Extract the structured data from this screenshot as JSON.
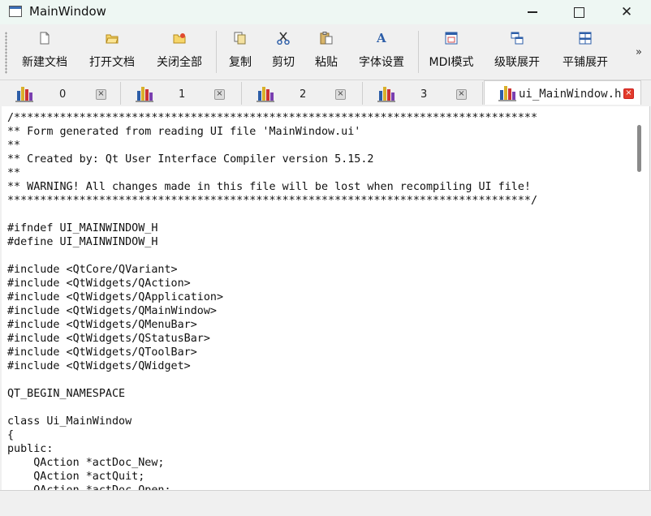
{
  "window": {
    "title": "MainWindow",
    "minimize_label": "–",
    "close_label": "✕"
  },
  "toolbar": {
    "buttons": [
      {
        "label": "新建文档",
        "icon": "new-document-icon"
      },
      {
        "label": "打开文档",
        "icon": "open-folder-icon"
      },
      {
        "label": "关闭全部",
        "icon": "close-all-icon"
      },
      {
        "label": "复制",
        "icon": "copy-icon"
      },
      {
        "label": "剪切",
        "icon": "cut-icon"
      },
      {
        "label": "粘贴",
        "icon": "paste-icon"
      },
      {
        "label": "字体设置",
        "icon": "font-icon"
      },
      {
        "label": "MDI模式",
        "icon": "mdi-mode-icon"
      },
      {
        "label": "级联展开",
        "icon": "cascade-icon"
      },
      {
        "label": "平铺展开",
        "icon": "tile-icon"
      }
    ],
    "overflow_label": "»"
  },
  "tabs": [
    {
      "label": "0",
      "active": false
    },
    {
      "label": "1",
      "active": false
    },
    {
      "label": "2",
      "active": false
    },
    {
      "label": "3",
      "active": false
    },
    {
      "label": "ui_MainWindow.h",
      "active": true
    }
  ],
  "editor": {
    "content": "/********************************************************************************\n** Form generated from reading UI file 'MainWindow.ui'\n**\n** Created by: Qt User Interface Compiler version 5.15.2\n**\n** WARNING! All changes made in this file will be lost when recompiling UI file!\n********************************************************************************/\n\n#ifndef UI_MAINWINDOW_H\n#define UI_MAINWINDOW_H\n\n#include <QtCore/QVariant>\n#include <QtWidgets/QAction>\n#include <QtWidgets/QApplication>\n#include <QtWidgets/QMainWindow>\n#include <QtWidgets/QMenuBar>\n#include <QtWidgets/QStatusBar>\n#include <QtWidgets/QToolBar>\n#include <QtWidgets/QWidget>\n\nQT_BEGIN_NAMESPACE\n\nclass Ui_MainWindow\n{\npublic:\n    QAction *actDoc_New;\n    QAction *actQuit;\n    QAction *actDoc_Open;"
  },
  "colors": {
    "titlebar_bg": "#eef7f3",
    "accent_blue": "#2d6fd0",
    "close_tab_red": "#e23b2a"
  }
}
